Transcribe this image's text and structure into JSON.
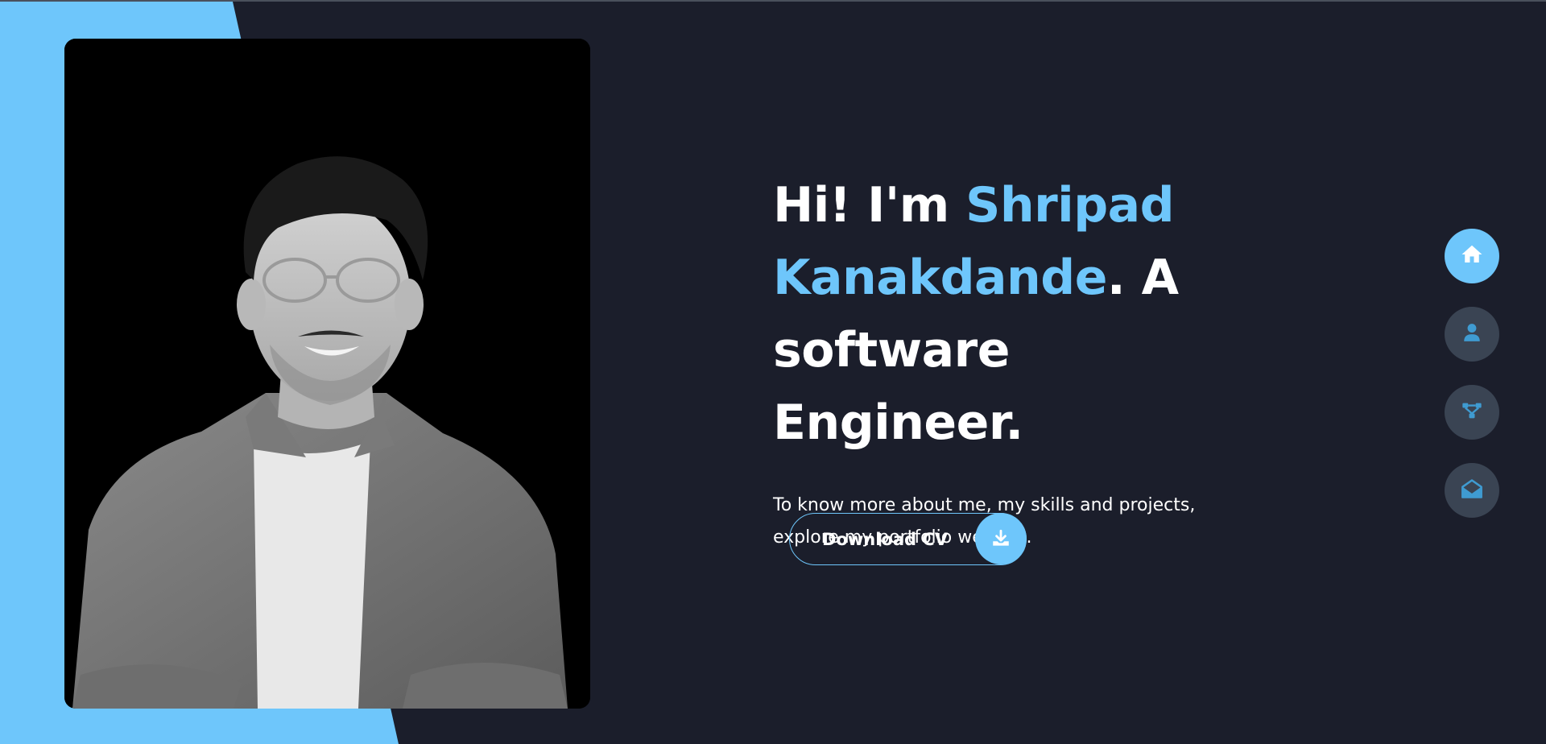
{
  "colors": {
    "background": "#1b1e2b",
    "accent": "#6ec6fb",
    "nav_inactive": "#3a4453",
    "text": "#ffffff"
  },
  "hero": {
    "greeting": "Hi! I'm ",
    "name": "Shripad Kanakdande",
    "title_suffix": ". A software Engineer.",
    "description": "To know more about me, my skills and projects, explore my portfolio website."
  },
  "cv_button": {
    "label": "Download CV",
    "icon": "download-icon"
  },
  "side_nav": [
    {
      "icon": "home-icon",
      "active": true
    },
    {
      "icon": "user-icon",
      "active": false
    },
    {
      "icon": "projects-icon",
      "active": false
    },
    {
      "icon": "contact-icon",
      "active": false
    }
  ]
}
